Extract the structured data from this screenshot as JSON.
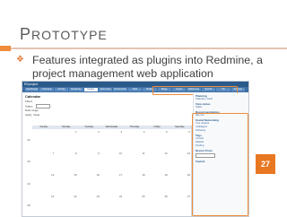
{
  "slide": {
    "title_first": "P",
    "title_rest": "ROTOTYPE",
    "bullet": "Features integrated as plugins into Redmine, a project management web application",
    "page_number": "27"
  },
  "screenshot": {
    "app_name": "EEproject",
    "page_title": "Calendar",
    "filters": {
      "heading": "Filters",
      "status_label": "Status",
      "date_range_label": "Date range",
      "apply": "Apply",
      "clear": "Clear"
    },
    "tabs": [
      "Dashboard",
      "Overview",
      "Activity",
      "Roadmap",
      "Issues",
      "New issue",
      "Documents",
      "Files",
      "Builds",
      "Blogs",
      "Topics",
      "Reference",
      "Search",
      "FS",
      "Settings"
    ],
    "selected_tab_index": 4,
    "weekdays": [
      "Sunday",
      "Monday",
      "Tuesday",
      "Wednesday",
      "Thursday",
      "Friday",
      "Saturday"
    ],
    "weeks": [
      {
        "num": "22",
        "days": [
          "",
          "1",
          "2",
          "3",
          "4",
          "5",
          "6"
        ]
      },
      {
        "num": "23",
        "days": [
          "7",
          "8",
          "9",
          "10",
          "11",
          "12",
          "13"
        ]
      },
      {
        "num": "24",
        "days": [
          "14",
          "15",
          "16",
          "17",
          "18",
          "19",
          "20"
        ]
      },
      {
        "num": "25",
        "days": [
          "21",
          "22",
          "23",
          "24",
          "25",
          "26",
          "27"
        ]
      }
    ],
    "sidebar": {
      "planning_heading": "Planning",
      "planning_link": "Calendar | Gantt",
      "view_heading": "View status",
      "view_item": "Status",
      "reco_heading": "Recommendations",
      "reco_link": "See one",
      "social_heading": "Social Networking",
      "social_links": [
        "Your network",
        "Colleagues",
        "Following"
      ],
      "tags_heading": "Tags",
      "tags": [
        "Consult",
        "Related",
        "Pending"
      ],
      "recent_heading": "Recent Posts",
      "topical_heading": "Topical"
    }
  }
}
